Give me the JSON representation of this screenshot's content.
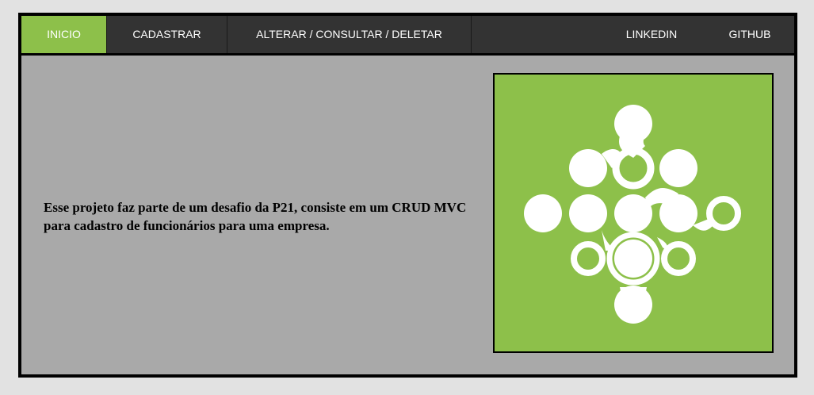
{
  "colors": {
    "accent": "#8dc04a",
    "navbar": "#333333",
    "content_bg": "#a9a9a9",
    "page_bg": "#e2e2e2"
  },
  "nav": {
    "items": [
      {
        "label": "INICIO",
        "active": true
      },
      {
        "label": "CADASTRAR"
      },
      {
        "label": "ALTERAR / CONSULTAR / DELETAR"
      },
      {
        "label": "LINKEDIN"
      },
      {
        "label": "GITHUB"
      }
    ]
  },
  "main": {
    "description": "Esse projeto faz parte de um desafio da P21, consiste em um CRUD MVC para cadastro de funcionários para uma empresa.",
    "logo_icon": "circle-network-logo-icon"
  }
}
